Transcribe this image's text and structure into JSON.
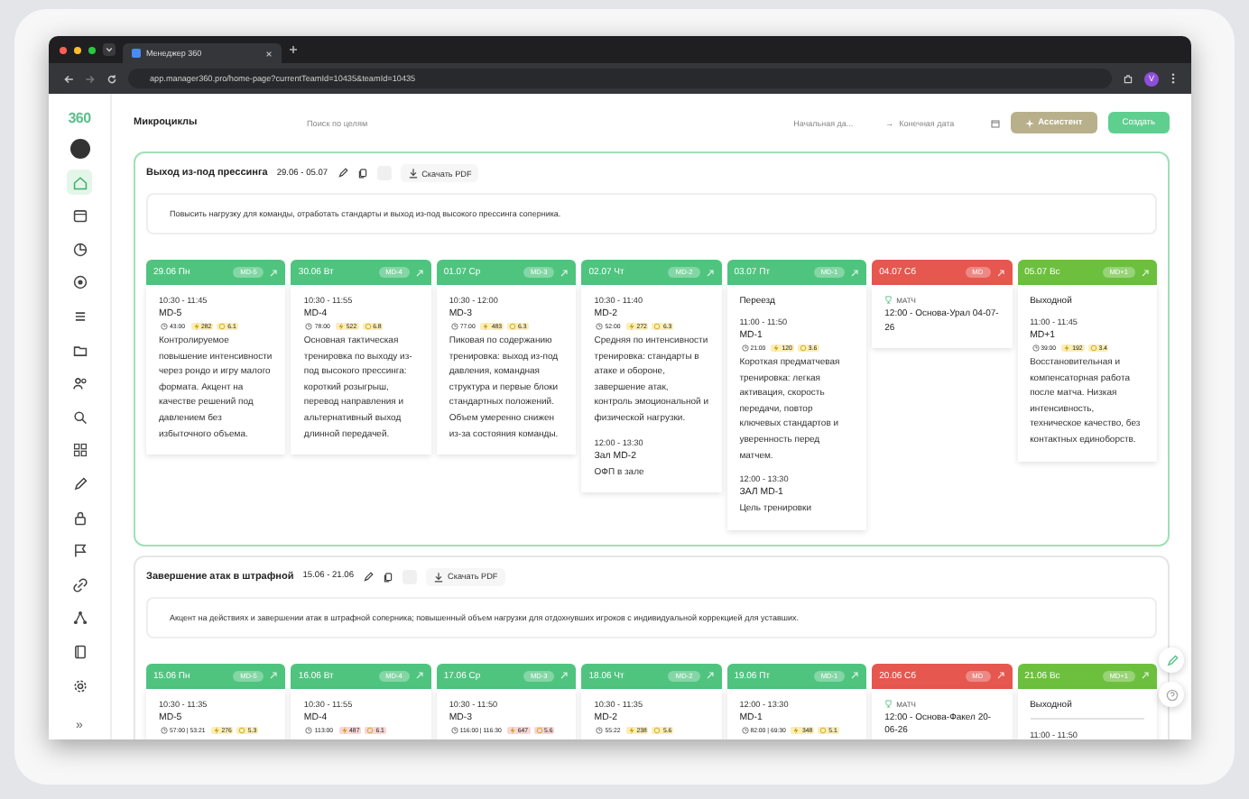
{
  "browser": {
    "tab_title": "Менеджер 360",
    "url": "app.manager360.pro/home-page?currentTeamId=10435&teamId=10435",
    "profile": "V"
  },
  "sidebar": {
    "logo": "360",
    "nav": [
      {
        "selected": true
      },
      {
        "selected": false
      },
      {
        "selected": false
      },
      {
        "selected": false
      },
      {
        "selected": false
      },
      {
        "selected": false
      },
      {
        "selected": false
      },
      {
        "selected": false
      },
      {
        "selected": false
      },
      {
        "selected": false
      },
      {
        "selected": false
      },
      {
        "selected": false
      },
      {
        "selected": false
      },
      {
        "selected": false
      },
      {
        "selected": false
      },
      {
        "selected": false
      }
    ],
    "expand": "»"
  },
  "header": {
    "title": "Микроциклы",
    "search": {
      "placeholder": "Поиск по целям"
    },
    "date_start": {
      "placeholder": "Начальная да..."
    },
    "arrow": "→",
    "date_end": {
      "placeholder": "Конечная дата"
    },
    "assistant_button": "Ассистент",
    "create_button": "Создать"
  },
  "sections": [
    {
      "title": "Выход из-под прессинга",
      "dates": "29.06 - 05.07",
      "pdf_button": "Скачать PDF",
      "highlighted": true,
      "description": "Повысить нагрузку для команды, отработать стандарты и выход из-под высокого прессинга соперника.",
      "days": [
        {
          "date": "29.06 Пн",
          "badge": "MD-5",
          "kind": "training",
          "entries": [
            {
              "kind": "session",
              "time": "10:30 - 11:45",
              "title": "MD-5",
              "stats": {
                "duration": "43:00",
                "load": "282",
                "rating": "6.1",
                "alert": false
              },
              "text": "Контролируемое повышение интенсивности через рондо и игру малого формата. Акцент на качестве решений под давлением без избыточного объема."
            }
          ]
        },
        {
          "date": "30.06 Вт",
          "badge": "MD-4",
          "kind": "training",
          "entries": [
            {
              "kind": "session",
              "time": "10:30 - 11:55",
              "title": "MD-4",
              "stats": {
                "duration": "78:00",
                "load": "522",
                "rating": "6.8",
                "alert": false
              },
              "text": "Основная тактическая тренировка по выходу из-под высокого прессинга: короткий розыгрыш, перевод направления и альтернативный выход длинной передачей."
            }
          ]
        },
        {
          "date": "01.07 Ср",
          "badge": "MD-3",
          "kind": "training",
          "entries": [
            {
              "kind": "session",
              "time": "10:30 - 12:00",
              "title": "MD-3",
              "stats": {
                "duration": "77:00",
                "load": "483",
                "rating": "6.3",
                "alert": false
              },
              "text": "Пиковая по содержанию тренировка: выход из-под давления, командная структура и первые блоки стандартных положений. Объем умеренно снижен из-за состояния команды."
            }
          ]
        },
        {
          "date": "02.07 Чт",
          "badge": "MD-2",
          "kind": "training",
          "entries": [
            {
              "kind": "session",
              "time": "10:30 - 11:40",
              "title": "MD-2",
              "stats": {
                "duration": "52:00",
                "load": "272",
                "rating": "6.3",
                "alert": false
              },
              "text": "Средняя по интенсивности тренировка: стандарты в атаке и обороне, завершение атак, контроль эмоциональной и физической нагрузки."
            },
            {
              "kind": "session",
              "time": "12:00 - 13:30",
              "title": "Зал MD-2",
              "text": "ОФП в зале"
            }
          ]
        },
        {
          "date": "03.07 Пт",
          "badge": "MD-1",
          "kind": "training",
          "entries": [
            {
              "kind": "note",
              "text": "Переезд"
            },
            {
              "kind": "session",
              "time": "11:00 - 11:50",
              "title": "MD-1",
              "stats": {
                "duration": "21:00",
                "load": "120",
                "rating": "3.6",
                "alert": false
              },
              "text": "Короткая предматчевая тренировка: легкая активация, скорость передачи, повтор ключевых стандартов и уверенность перед матчем."
            },
            {
              "kind": "session",
              "time": "12:00 - 13:30",
              "title": "ЗАЛ MD-1",
              "text": "Цель тренировки"
            }
          ]
        },
        {
          "date": "04.07 Сб",
          "badge": "MD",
          "kind": "match",
          "entries": [
            {
              "kind": "match",
              "label": "МАТЧ",
              "text": "12:00 - Основа-Урал 04-07-26"
            }
          ]
        },
        {
          "date": "05.07 Вс",
          "badge": "MD+1",
          "kind": "rest",
          "entries": [
            {
              "kind": "note",
              "text": "Выходной"
            },
            {
              "kind": "session",
              "time": "11:00 - 11:45",
              "title": "MD+1",
              "stats": {
                "duration": "39:00",
                "load": "192",
                "rating": "3.4",
                "alert": false
              },
              "text": "Восстановительная и компенсаторная работа после матча. Низкая интенсивность, техническое качество, без контактных единоборств."
            }
          ]
        }
      ]
    },
    {
      "title": "Завершение атак в штрафной",
      "dates": "15.06 - 21.06",
      "pdf_button": "Скачать PDF",
      "highlighted": false,
      "description": "Акцент на действиях и завершении атак в штрафной соперника; повышенный объем нагрузки для отдохнувших игроков с индивидуальной коррекцией для уставших.",
      "days": [
        {
          "date": "15.06 Пн",
          "badge": "MD-5",
          "kind": "training",
          "entries": [
            {
              "kind": "session",
              "time": "10:30 - 11:35",
              "title": "MD-5",
              "stats": {
                "duration": "57:00 | 53:21",
                "load": "276",
                "rating": "5.3",
                "alert": false
              }
            }
          ]
        },
        {
          "date": "16.06 Вт",
          "badge": "MD-4",
          "kind": "training",
          "entries": [
            {
              "kind": "session",
              "time": "10:30 - 11:55",
              "title": "MD-4",
              "stats": {
                "duration": "113:00",
                "load": "487",
                "rating": "6.1",
                "alert": true
              }
            }
          ]
        },
        {
          "date": "17.06 Ср",
          "badge": "MD-3",
          "kind": "training",
          "entries": [
            {
              "kind": "session",
              "time": "10:30 - 11:50",
              "title": "MD-3",
              "stats": {
                "duration": "116:00 | 116:30",
                "load": "647",
                "rating": "5.6",
                "alert": true
              }
            }
          ]
        },
        {
          "date": "18.06 Чт",
          "badge": "MD-2",
          "kind": "training",
          "entries": [
            {
              "kind": "session",
              "time": "10:30 - 11:35",
              "title": "MD-2",
              "stats": {
                "duration": "55:22",
                "load": "238",
                "rating": "5.6",
                "alert": false
              }
            }
          ]
        },
        {
          "date": "19.06 Пт",
          "badge": "MD-1",
          "kind": "training",
          "entries": [
            {
              "kind": "session",
              "time": "12:00 - 13:30",
              "title": "MD-1",
              "stats": {
                "duration": "82:00 | 69:30",
                "load": "348",
                "rating": "5.1",
                "alert": false
              }
            }
          ]
        },
        {
          "date": "20.06 Сб",
          "badge": "MD",
          "kind": "match",
          "entries": [
            {
              "kind": "match",
              "label": "МАТЧ",
              "text": "12:00 - Основа-Факел 20-06-26"
            }
          ]
        },
        {
          "date": "21.06 Вс",
          "badge": "MD+1",
          "kind": "rest",
          "entries": [
            {
              "kind": "note",
              "text": "Выходной"
            },
            {
              "kind": "session",
              "time": "11:00 - 11:50"
            }
          ]
        }
      ]
    }
  ]
}
